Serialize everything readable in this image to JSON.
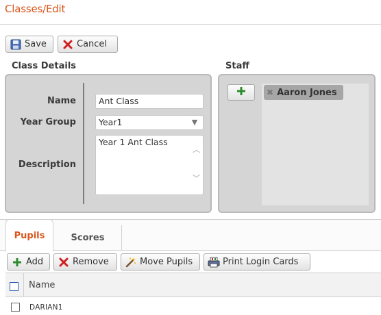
{
  "page": {
    "title": "Classes/Edit"
  },
  "toolbar": {
    "save_label": "Save",
    "cancel_label": "Cancel"
  },
  "class_details": {
    "heading": "Class Details",
    "name_label": "Name",
    "name_value": "Ant Class",
    "year_group_label": "Year Group",
    "year_group_value": "Year1",
    "description_label": "Description",
    "description_value": "Year 1 Ant Class"
  },
  "staff": {
    "heading": "Staff",
    "members": [
      "Aaron Jones"
    ]
  },
  "tabs": [
    {
      "label": "Pupils",
      "active": true
    },
    {
      "label": "Scores",
      "active": false
    }
  ],
  "pupil_toolbar": {
    "add_label": "Add",
    "remove_label": "Remove",
    "move_label": "Move Pupils",
    "print_label": "Print Login Cards"
  },
  "pupils_grid": {
    "column_name": "Name",
    "rows": [
      {
        "name": "DARIAN1"
      }
    ]
  },
  "colors": {
    "accent": "#d9561d",
    "panel": "#d5d5d5",
    "add_green": "#2e8b2e",
    "cancel_red": "#d02020"
  }
}
